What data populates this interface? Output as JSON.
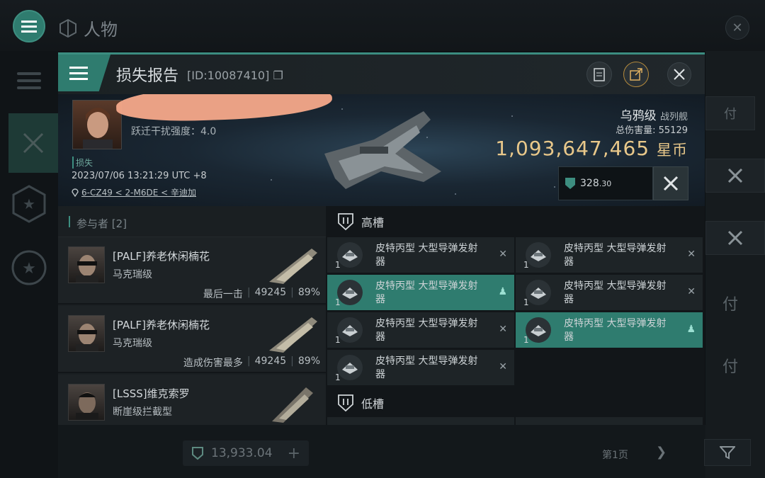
{
  "background": {
    "title": "人物",
    "right_boxes": [
      "付",
      "付",
      "付",
      "付"
    ],
    "isk_value": "13,933.04",
    "page_label": "第1页"
  },
  "modal": {
    "title": "损失报告",
    "id": "[ID:10087410]",
    "victim": {
      "warp_strength": "跃迁干扰强度：4.0",
      "loss_label": "损失",
      "datetime": "2023/07/06 13:21:29 UTC +8",
      "location": "6-CZ49 < 2-M6DE < 辛迪加"
    },
    "ship": {
      "name": "乌鸦级",
      "type": "战列舰",
      "total_damage_label": "总伤害量:",
      "total_damage": "55129",
      "isk_value": "1,093,647,465",
      "isk_unit": "星币",
      "plex_value": "328",
      "plex_decimal": ".30"
    },
    "participants": {
      "header": "参与者 [2]",
      "rows": [
        {
          "name": "[PALF]养老休闲楠花",
          "ship": "马克瑞级",
          "tag": "最后一击",
          "damage": "49245",
          "percent": "89%"
        },
        {
          "name": "[PALF]养老休闲楠花",
          "ship": "马克瑞级",
          "tag": "造成伤害最多",
          "damage": "49245",
          "percent": "89%"
        },
        {
          "name": "[LSSS]维克索罗",
          "ship": "断崖级拦截型",
          "tag": "",
          "damage": "",
          "percent": ""
        }
      ]
    },
    "modules": {
      "high_slot_label": "高槽",
      "low_slot_label": "低槽",
      "high": [
        {
          "name": "皮特丙型 大型导弹发射器",
          "qty": "1",
          "status": "destroyed"
        },
        {
          "name": "皮特丙型 大型导弹发射器",
          "qty": "1",
          "status": "destroyed"
        },
        {
          "name": "皮特丙型 大型导弹发射器",
          "qty": "1",
          "status": "dropped"
        },
        {
          "name": "皮特丙型 大型导弹发射器",
          "qty": "1",
          "status": "destroyed"
        },
        {
          "name": "皮特丙型 大型导弹发射器",
          "qty": "1",
          "status": "destroyed"
        },
        {
          "name": "皮特丙型 大型导弹发射器",
          "qty": "1",
          "status": "dropped"
        },
        {
          "name": "皮特丙型 大型导弹发射器",
          "qty": "1",
          "status": "destroyed"
        }
      ]
    }
  },
  "colors": {
    "accent": "#2f7c6f",
    "isk": "#e9c88a"
  }
}
